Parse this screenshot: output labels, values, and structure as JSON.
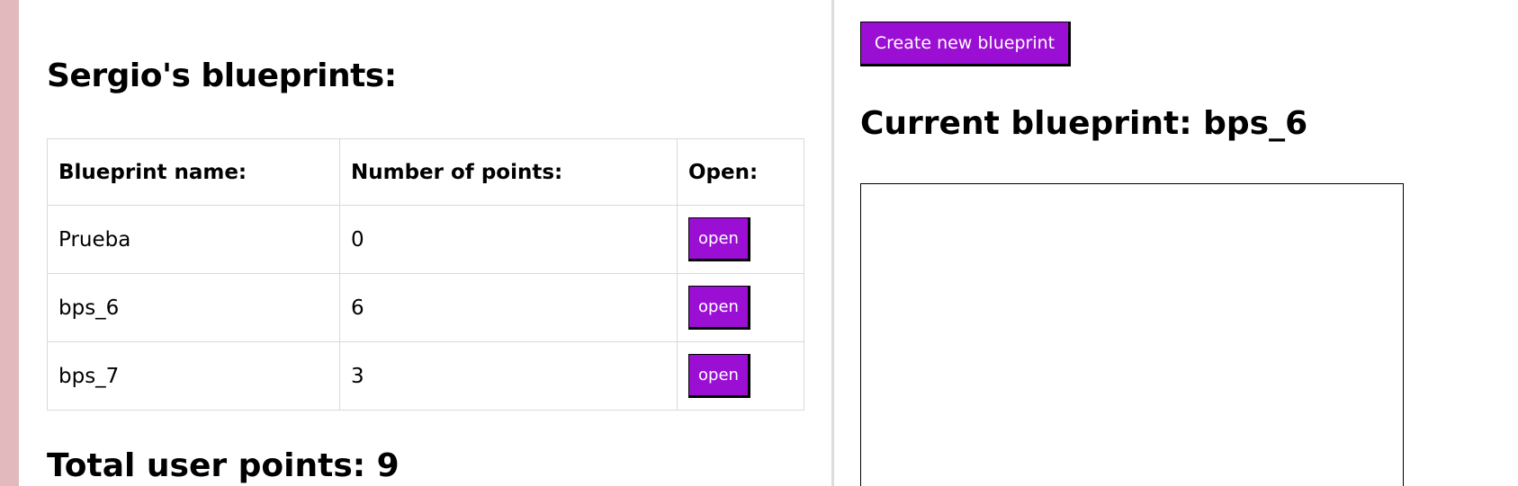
{
  "left": {
    "title": "Sergio's blueprints:",
    "table": {
      "headers": [
        "Blueprint name:",
        "Number of points:",
        "Open:"
      ],
      "rows": [
        {
          "name": "Prueba",
          "points": "0",
          "action": "open"
        },
        {
          "name": "bps_6",
          "points": "6",
          "action": "open"
        },
        {
          "name": "bps_7",
          "points": "3",
          "action": "open"
        }
      ]
    },
    "total": "Total user points: 9"
  },
  "right": {
    "create_label": "Create new blueprint",
    "current": "Current blueprint: bps_6"
  },
  "colors": {
    "accent": "#9b0fd4",
    "stripe": "#e2b9bc"
  }
}
